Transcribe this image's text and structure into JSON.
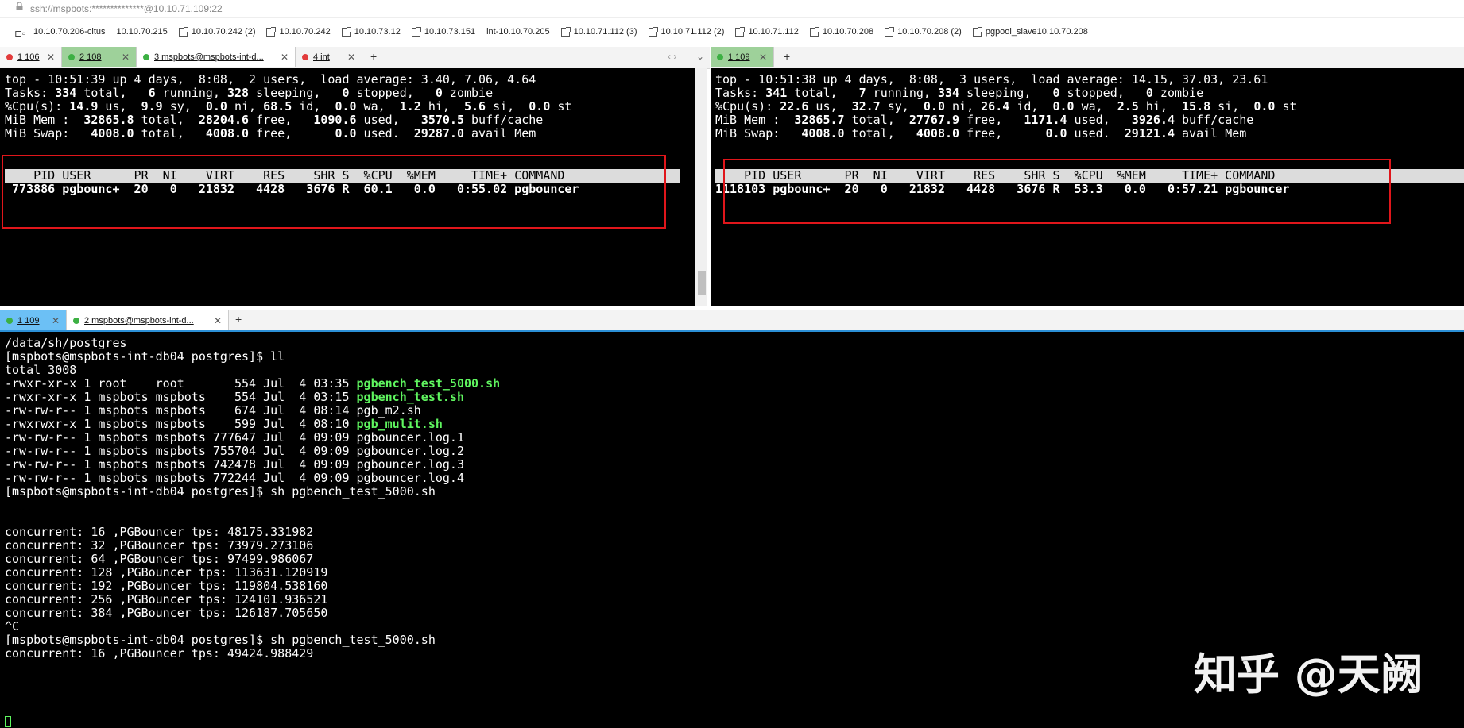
{
  "window": {
    "title": "ssh://mspbots:**************@10.10.71.109:22"
  },
  "bookmarks": [
    {
      "label": "10.10.70.206-citus",
      "ext": false
    },
    {
      "label": "10.10.70.215",
      "ext": false
    },
    {
      "label": "10.10.70.242 (2)",
      "ext": true
    },
    {
      "label": "10.10.70.242",
      "ext": true
    },
    {
      "label": "10.10.73.12",
      "ext": true
    },
    {
      "label": "10.10.73.151",
      "ext": true
    },
    {
      "label": "int-10.10.70.205",
      "ext": false
    },
    {
      "label": "10.10.71.112 (3)",
      "ext": true
    },
    {
      "label": "10.10.71.112 (2)",
      "ext": true
    },
    {
      "label": "10.10.71.112",
      "ext": true
    },
    {
      "label": "10.10.70.208",
      "ext": true
    },
    {
      "label": "10.10.70.208 (2)",
      "ext": true
    },
    {
      "label": "pgpool_slave10.10.70.208",
      "ext": true
    }
  ],
  "left_tabs": [
    {
      "label": "1 106",
      "dot": "#e23b3b"
    },
    {
      "label": "2 108",
      "dot": "#3cb043"
    },
    {
      "label": "3 mspbots@mspbots-int-d...",
      "dot": "#3cb043"
    },
    {
      "label": "4 int",
      "dot": "#e23b3b"
    }
  ],
  "right_tabs": [
    {
      "label": "1 109",
      "dot": "#3cb043"
    }
  ],
  "bottom_tabs": [
    {
      "label": "1 109",
      "dot": "#3cb043"
    },
    {
      "label": "2 mspbots@mspbots-int-d...",
      "dot": "#3cb043"
    }
  ],
  "left_top": {
    "line1": "top - 10:51:39 up 4 days,  8:08,  2 users,  load average: 3.40, 7.06, 4.64",
    "tasks_total": "334",
    "tasks_running": "6",
    "tasks_sleeping": "328",
    "tasks_stopped": "0",
    "tasks_zombie": "0",
    "cpu": [
      "14.9",
      "9.9",
      "0.0",
      "68.5",
      "0.0",
      "1.2",
      "5.6",
      "0.0"
    ],
    "mem": [
      "32865.8",
      "28204.6",
      "1090.6",
      "3570.5"
    ],
    "swap": [
      "4008.0",
      "4008.0",
      "0.0",
      "29287.0"
    ],
    "header": "    PID USER      PR  NI    VIRT    RES    SHR S  %CPU  %MEM     TIME+ COMMAND",
    "row": " 773886 pgbounc+  20   0   21832   4428   3676 R  60.1   0.0   0:55.02 pgbouncer"
  },
  "right_top": {
    "line1": "top - 10:51:38 up 4 days,  8:08,  3 users,  load average: 14.15, 37.03, 23.61",
    "tasks_total": "341",
    "tasks_running": "7",
    "tasks_sleeping": "334",
    "tasks_stopped": "0",
    "tasks_zombie": "0",
    "cpu": [
      "22.6",
      "32.7",
      "0.0",
      "26.4",
      "0.0",
      "2.5",
      "15.8",
      "0.0"
    ],
    "mem": [
      "32865.7",
      "27767.9",
      "1171.4",
      "3926.4"
    ],
    "swap": [
      "4008.0",
      "4008.0",
      "0.0",
      "29121.4"
    ],
    "header": "    PID USER      PR  NI    VIRT    RES    SHR S  %CPU  %MEM     TIME+ COMMAND",
    "row": "1118103 pgbounc+  20   0   21832   4428   3676 R  53.3   0.0   0:57.21 pgbouncer"
  },
  "bottom_term": {
    "pwd": "/data/sh/postgres",
    "prompt1": "[mspbots@mspbots-int-db04 postgres]$ ll",
    "total": "total 3008",
    "files": [
      {
        "meta": "-rwxr-xr-x 1 root    root       554 Jul  4 03:35 ",
        "name": "pgbench_test_5000.sh",
        "exec": true
      },
      {
        "meta": "-rwxr-xr-x 1 mspbots mspbots    554 Jul  4 03:15 ",
        "name": "pgbench_test.sh",
        "exec": true
      },
      {
        "meta": "-rw-rw-r-- 1 mspbots mspbots    674 Jul  4 08:14 ",
        "name": "pgb_m2.sh",
        "exec": false
      },
      {
        "meta": "-rwxrwxr-x 1 mspbots mspbots    599 Jul  4 08:10 ",
        "name": "pgb_mulit.sh",
        "exec": true
      },
      {
        "meta": "-rw-rw-r-- 1 mspbots mspbots 777647 Jul  4 09:09 ",
        "name": "pgbouncer.log.1",
        "exec": false
      },
      {
        "meta": "-rw-rw-r-- 1 mspbots mspbots 755704 Jul  4 09:09 ",
        "name": "pgbouncer.log.2",
        "exec": false
      },
      {
        "meta": "-rw-rw-r-- 1 mspbots mspbots 742478 Jul  4 09:09 ",
        "name": "pgbouncer.log.3",
        "exec": false
      },
      {
        "meta": "-rw-rw-r-- 1 mspbots mspbots 772244 Jul  4 09:09 ",
        "name": "pgbouncer.log.4",
        "exec": false
      }
    ],
    "prompt2": "[mspbots@mspbots-int-db04 postgres]$ sh pgbench_test_5000.sh",
    "results": [
      "concurrent: 16 ,PGBouncer tps: 48175.331982",
      "concurrent: 32 ,PGBouncer tps: 73979.273106",
      "concurrent: 64 ,PGBouncer tps: 97499.986067",
      "concurrent: 128 ,PGBouncer tps: 113631.120919",
      "concurrent: 192 ,PGBouncer tps: 119804.538160",
      "concurrent: 256 ,PGBouncer tps: 124101.936521",
      "concurrent: 384 ,PGBouncer tps: 126187.705650"
    ],
    "interrupt": "^C",
    "prompt3": "[mspbots@mspbots-int-db04 postgres]$ sh pgbench_test_5000.sh",
    "last": "concurrent: 16 ,PGBouncer tps: 49424.988429"
  },
  "watermark": "知乎 @天阙"
}
